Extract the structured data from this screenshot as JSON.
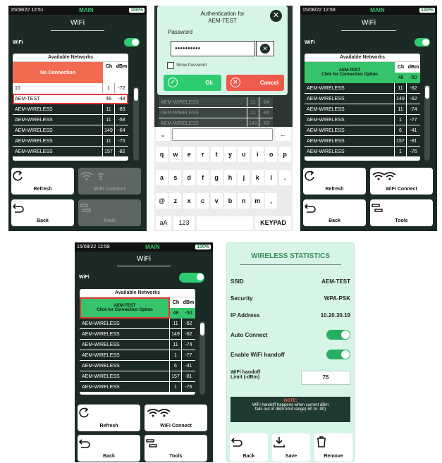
{
  "common": {
    "main": "MAIN",
    "battery": "100%",
    "wifi_title": "WiFi",
    "wifi_label": "WiFi",
    "available": "Available Networks",
    "ch": "Ch",
    "dbm": "dBm",
    "refresh": "Refresh",
    "wifi_connect": "WiFi Connect",
    "back": "Back",
    "tools": "Tools"
  },
  "s1": {
    "time": "15/08/22 12:51",
    "no_connection": "No Connection",
    "rows": [
      {
        "n": "10",
        "c": "1",
        "d": "-72"
      },
      {
        "n": "AEM-TEST",
        "c": "48",
        "d": "-48"
      },
      {
        "n": "AEM-WIRELESS",
        "c": "11",
        "d": "-83"
      },
      {
        "n": "AEM-WIRELESS",
        "c": "11",
        "d": "-58"
      },
      {
        "n": "AEM-WIRELESS",
        "c": "149",
        "d": "-64"
      },
      {
        "n": "AEM-WIRELESS",
        "c": "11",
        "d": "-75"
      },
      {
        "n": "AEM-WIRELESS",
        "c": "157",
        "d": "-82"
      }
    ]
  },
  "s2": {
    "auth_title_1": "Authentication for",
    "auth_title_2": "AEM-TEST",
    "password_label": "Password",
    "password_value": "●●●●●●●●●●",
    "show_password": "Show Password",
    "ok": "Ok",
    "cancel": "Cancel",
    "bg_rows": [
      {
        "n": "AEM-WIRELESS",
        "c": "11",
        "d": "-84"
      },
      {
        "n": "AEM-WIRELESS",
        "c": "11",
        "d": "-65"
      },
      {
        "n": "AEM-WIRELESS",
        "c": "149",
        "d": "-63"
      }
    ],
    "keys_row1": [
      "q",
      "w",
      "e",
      "r",
      "t",
      "y",
      "u",
      "i",
      "o",
      "p"
    ],
    "keys_row2": [
      "a",
      "s",
      "d",
      "f",
      "g",
      "h",
      "j",
      "k",
      "l",
      "."
    ],
    "keys_row3": [
      "@",
      "z",
      "x",
      "c",
      "v",
      "b",
      "n",
      "m",
      ","
    ],
    "key_aa": "aA",
    "key_123": "123",
    "key_keypad": "KEYPAD"
  },
  "s3": {
    "time": "15/08/22 12:58",
    "connected_name": "AEM-TEST",
    "connected_hint": "Click for Connection Option",
    "connected_ch": "48",
    "connected_dbm": "-50",
    "rows": [
      {
        "n": "AEM-WIRELESS",
        "c": "11",
        "d": "-62"
      },
      {
        "n": "AEM-WIRELESS",
        "c": "149",
        "d": "-62"
      },
      {
        "n": "AEM-WIRELESS",
        "c": "11",
        "d": "-74"
      },
      {
        "n": "AEM-WIRELESS",
        "c": "1",
        "d": "-77"
      },
      {
        "n": "AEM-WIRELESS",
        "c": "6",
        "d": "-41"
      },
      {
        "n": "AEM-WIRELESS",
        "c": "157",
        "d": "-81"
      },
      {
        "n": "AEM-WIRELESS",
        "c": "1",
        "d": "-76"
      }
    ]
  },
  "s5": {
    "title": "WIRELESS STATISTICS",
    "ssid_label": "SSID",
    "ssid": "AEM-TEST",
    "security_label": "Security",
    "security": "WPA-PSK",
    "ip_label": "IP Address",
    "ip": "10.20.30.19",
    "auto_connect": "Auto Connect",
    "handoff": "Enable WiFi handoff",
    "limit_label_1": "WiFi handoff",
    "limit_label_2": "Limit (-dBm)",
    "limit_value": "75",
    "note_title": "NOTE:",
    "note_1": "WiFi handoff happens when current dBm",
    "note_2": "falls out of dBm limit range(-60 to -90)",
    "back": "Back",
    "save": "Save",
    "remove": "Remove"
  },
  "colors": {
    "bg": "#1c2a25",
    "accent_green": "#2ecc71",
    "no_conn_red": "#f26b50",
    "connected_green": "#35c46c",
    "cancel_red": "#f05a4a",
    "stats_bg": "#d6f5e6"
  }
}
